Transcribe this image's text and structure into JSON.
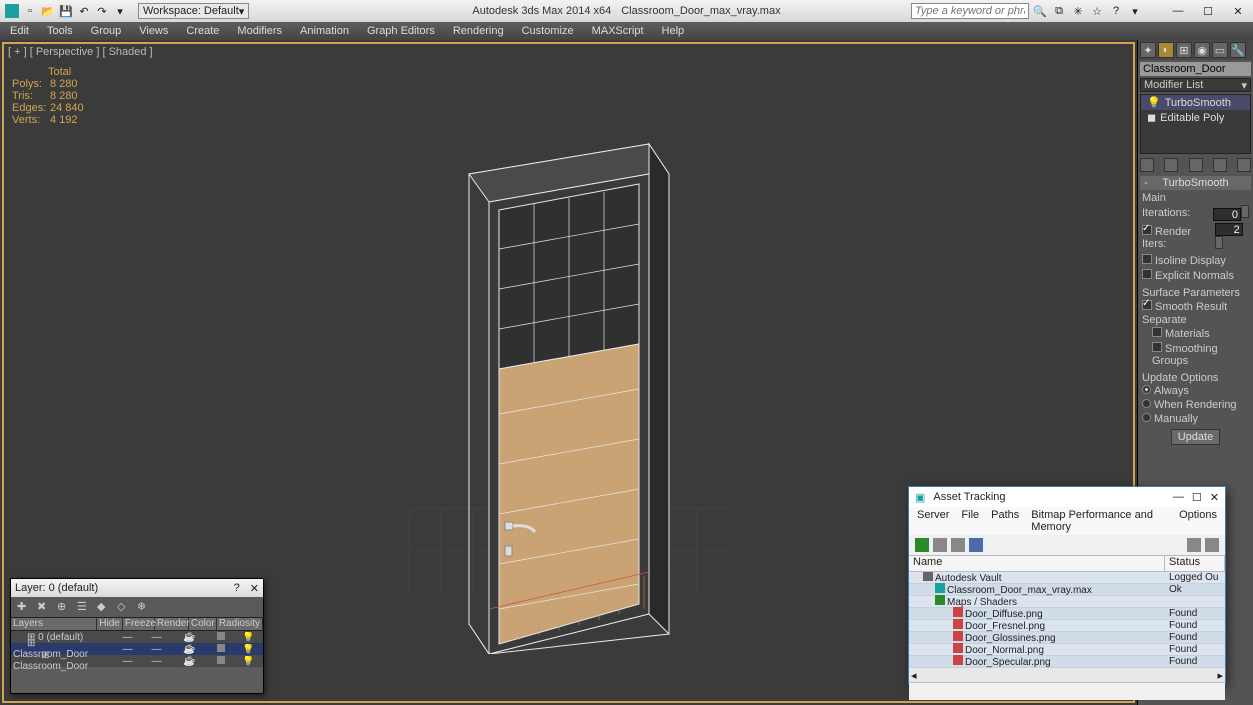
{
  "titlebar": {
    "app": "Autodesk 3ds Max  2014 x64",
    "file": "Classroom_Door_max_vray.max",
    "workspace_label": "Workspace: Default",
    "search_placeholder": "Type a keyword or phrase"
  },
  "menu": [
    "Edit",
    "Tools",
    "Group",
    "Views",
    "Create",
    "Modifiers",
    "Animation",
    "Graph Editors",
    "Rendering",
    "Customize",
    "MAXScript",
    "Help"
  ],
  "viewport": {
    "label": "[ + ] [ Perspective ] [ Shaded ]",
    "stats_header": "Total",
    "stats": [
      {
        "lbl": "Polys:",
        "val": "8 280"
      },
      {
        "lbl": "Tris:",
        "val": "8 280"
      },
      {
        "lbl": "Edges:",
        "val": "24 840"
      },
      {
        "lbl": "Verts:",
        "val": "4 192"
      }
    ]
  },
  "cmd": {
    "object_name": "Classroom_Door",
    "modifier_list": "Modifier List",
    "stack": [
      "TurboSmooth",
      "Editable Poly"
    ],
    "rollup_title": "TurboSmooth",
    "section_main": "Main",
    "iterations_lbl": "Iterations:",
    "iterations_val": "0",
    "render_iters_lbl": "Render Iters:",
    "render_iters_val": "2",
    "isoline": "Isoline Display",
    "explicit": "Explicit Normals",
    "section_surface": "Surface Parameters",
    "smooth_result": "Smooth Result",
    "separate": "Separate",
    "sep_materials": "Materials",
    "sep_smoothing": "Smoothing Groups",
    "section_update": "Update Options",
    "upd_always": "Always",
    "upd_render": "When Rendering",
    "upd_manual": "Manually",
    "update_btn": "Update"
  },
  "layer_win": {
    "title": "Layer: 0 (default)",
    "help": "?",
    "columns": [
      "Layers",
      "Hide",
      "Freeze",
      "Render",
      "Color",
      "Radiosity"
    ],
    "rows": [
      {
        "name": "0 (default)",
        "indent": 14,
        "sel": false
      },
      {
        "name": "Classroom_Door",
        "indent": 14,
        "sel": true
      },
      {
        "name": "Classroom_Door",
        "indent": 28,
        "sel": false
      }
    ]
  },
  "asset_win": {
    "title": "Asset Tracking",
    "menu": [
      "Server",
      "File",
      "Paths",
      "Bitmap Performance and Memory",
      "Options"
    ],
    "columns": {
      "name": "Name",
      "status": "Status"
    },
    "rows": [
      {
        "name": "Autodesk Vault",
        "status": "Logged Ou",
        "indent": 10,
        "icon": "vault"
      },
      {
        "name": "Classroom_Door_max_vray.max",
        "status": "Ok",
        "indent": 22,
        "icon": "max"
      },
      {
        "name": "Maps / Shaders",
        "status": "",
        "indent": 22,
        "icon": "folder"
      },
      {
        "name": "Door_Diffuse.png",
        "status": "Found",
        "indent": 40,
        "icon": "img"
      },
      {
        "name": "Door_Fresnel.png",
        "status": "Found",
        "indent": 40,
        "icon": "img"
      },
      {
        "name": "Door_Glossines.png",
        "status": "Found",
        "indent": 40,
        "icon": "img"
      },
      {
        "name": "Door_Normal.png",
        "status": "Found",
        "indent": 40,
        "icon": "img"
      },
      {
        "name": "Door_Specular.png",
        "status": "Found",
        "indent": 40,
        "icon": "img"
      }
    ]
  }
}
